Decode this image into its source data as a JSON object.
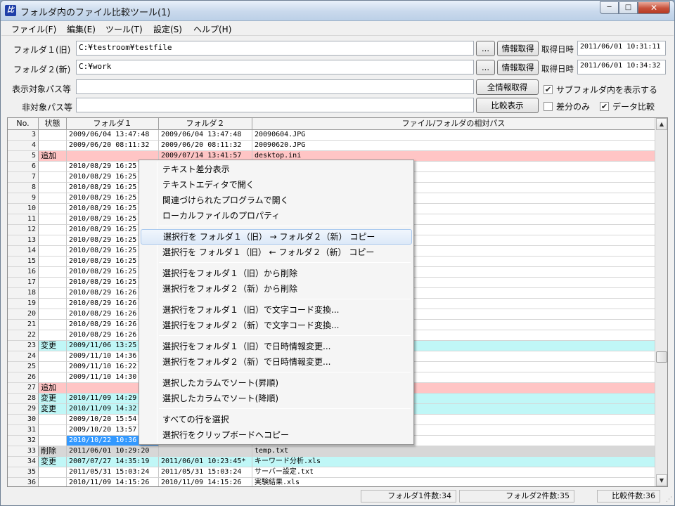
{
  "window": {
    "title": "フォルダ内のファイル比較ツール(1)",
    "app_icon": "比",
    "btn_min": "─",
    "btn_max": "□",
    "btn_close": "✕"
  },
  "menu": [
    "ファイル(F)",
    "編集(E)",
    "ツール(T)",
    "設定(S)",
    "ヘルプ(H)"
  ],
  "form": {
    "folder1_label": "フォルダ１(旧)",
    "folder1_value": "C:¥testroom¥testfile",
    "folder2_label": "フォルダ２(新)",
    "folder2_value": "C:¥work",
    "browse_label": "...",
    "getinfo_label": "情報取得",
    "time_label": "取得日時",
    "time1_value": "2011/06/01 10:31:11",
    "time2_value": "2011/06/01 10:34:32",
    "include_label": "表示対象パス等",
    "include_value": "",
    "exclude_label": "非対象パス等",
    "exclude_value": "",
    "getall_label": "全情報取得",
    "compare_label": "比較表示",
    "subfolder_label": "サブフォルダ内を表示する",
    "subfolder_checked": true,
    "diffonly_label": "差分のみ",
    "diffonly_checked": false,
    "datacompare_label": "データ比較",
    "datacompare_checked": true
  },
  "grid": {
    "headers": [
      "No.",
      "状態",
      "フォルダ１",
      "フォルダ２",
      "ファイル/フォルダの相対パス"
    ],
    "rows": [
      {
        "no": "3",
        "status": "",
        "d1": "2009/06/04 13:47:48",
        "d2": "2009/06/04 13:47:48",
        "path": "20090604.JPG",
        "kind": ""
      },
      {
        "no": "4",
        "status": "",
        "d1": "2009/06/20 08:11:32",
        "d2": "2009/06/20 08:11:32",
        "path": "20090620.JPG",
        "kind": ""
      },
      {
        "no": "5",
        "status": "追加",
        "d1": "",
        "d2": "2009/07/14 13:41:57",
        "path": "desktop.ini",
        "kind": "add"
      },
      {
        "no": "6",
        "status": "",
        "d1": "2010/08/29 16:25",
        "d2": "",
        "path": "",
        "kind": ""
      },
      {
        "no": "7",
        "status": "",
        "d1": "2010/08/29 16:25",
        "d2": "",
        "path": "",
        "kind": ""
      },
      {
        "no": "8",
        "status": "",
        "d1": "2010/08/29 16:25",
        "d2": "",
        "path": "",
        "kind": ""
      },
      {
        "no": "9",
        "status": "",
        "d1": "2010/08/29 16:25",
        "d2": "",
        "path": "",
        "kind": ""
      },
      {
        "no": "10",
        "status": "",
        "d1": "2010/08/29 16:25",
        "d2": "",
        "path": "",
        "kind": ""
      },
      {
        "no": "11",
        "status": "",
        "d1": "2010/08/29 16:25",
        "d2": "",
        "path": "",
        "kind": ""
      },
      {
        "no": "12",
        "status": "",
        "d1": "2010/08/29 16:25",
        "d2": "",
        "path": "",
        "kind": ""
      },
      {
        "no": "13",
        "status": "",
        "d1": "2010/08/29 16:25",
        "d2": "",
        "path": "",
        "kind": ""
      },
      {
        "no": "14",
        "status": "",
        "d1": "2010/08/29 16:25",
        "d2": "",
        "path": "",
        "kind": ""
      },
      {
        "no": "15",
        "status": "",
        "d1": "2010/08/29 16:25",
        "d2": "",
        "path": "",
        "kind": ""
      },
      {
        "no": "16",
        "status": "",
        "d1": "2010/08/29 16:25",
        "d2": "",
        "path": "",
        "kind": ""
      },
      {
        "no": "17",
        "status": "",
        "d1": "2010/08/29 16:25",
        "d2": "",
        "path": "",
        "kind": ""
      },
      {
        "no": "18",
        "status": "",
        "d1": "2010/08/29 16:26",
        "d2": "",
        "path": "",
        "kind": ""
      },
      {
        "no": "19",
        "status": "",
        "d1": "2010/08/29 16:26",
        "d2": "",
        "path": "",
        "kind": ""
      },
      {
        "no": "20",
        "status": "",
        "d1": "2010/08/29 16:26",
        "d2": "",
        "path": "",
        "kind": ""
      },
      {
        "no": "21",
        "status": "",
        "d1": "2010/08/29 16:26",
        "d2": "",
        "path": "",
        "kind": ""
      },
      {
        "no": "22",
        "status": "",
        "d1": "2010/08/29 16:26",
        "d2": "",
        "path": "",
        "kind": ""
      },
      {
        "no": "23",
        "status": "変更",
        "d1": "2009/11/06 13:25",
        "d2": "",
        "path": "",
        "kind": "chg"
      },
      {
        "no": "24",
        "status": "",
        "d1": "2009/11/10 14:36",
        "d2": "",
        "path": "",
        "kind": ""
      },
      {
        "no": "25",
        "status": "",
        "d1": "2009/11/10 16:22",
        "d2": "",
        "path": "",
        "kind": ""
      },
      {
        "no": "26",
        "status": "",
        "d1": "2009/11/10 14:30",
        "d2": "",
        "path": "",
        "kind": ""
      },
      {
        "no": "27",
        "status": "追加",
        "d1": "",
        "d2": "",
        "path": "",
        "kind": "add"
      },
      {
        "no": "28",
        "status": "変更",
        "d1": "2010/11/09 14:29",
        "d2": "",
        "path": "",
        "kind": "chg"
      },
      {
        "no": "29",
        "status": "変更",
        "d1": "2010/11/09 14:32",
        "d2": "",
        "path": "",
        "kind": "chg"
      },
      {
        "no": "30",
        "status": "",
        "d1": "2009/10/20 15:54",
        "d2": "",
        "path": "",
        "kind": ""
      },
      {
        "no": "31",
        "status": "",
        "d1": "2009/10/20 13:57",
        "d2": "",
        "path": "",
        "kind": ""
      },
      {
        "no": "32",
        "status": "",
        "d1": "2010/10/22 10:36",
        "d2": "",
        "path": "",
        "kind": "selected"
      },
      {
        "no": "33",
        "status": "削除",
        "d1": "2011/06/01 10:29:20",
        "d2": "",
        "path": "temp.txt",
        "kind": "del"
      },
      {
        "no": "34",
        "status": "変更",
        "d1": "2007/07/27 14:35:19",
        "d2": "2011/06/01 10:23:45*",
        "path": "キーワード分析.xls",
        "kind": "chg"
      },
      {
        "no": "35",
        "status": "",
        "d1": "2011/05/31 15:03:24",
        "d2": "2011/05/31 15:03:24",
        "path": "サーバー設定.txt",
        "kind": ""
      },
      {
        "no": "36",
        "status": "",
        "d1": "2010/11/09 14:15:26",
        "d2": "2010/11/09 14:15:26",
        "path": "実験結果.xls",
        "kind": ""
      }
    ]
  },
  "context_menu": {
    "groups": [
      [
        "テキスト差分表示",
        "テキストエディタで開く",
        "関連づけられたプログラムで開く",
        "ローカルファイルのプロパティ"
      ],
      [
        "選択行を フォルダ１（旧） → フォルダ２（新） コピー",
        "選択行を フォルダ１（旧） ← フォルダ２（新） コピー"
      ],
      [
        "選択行をフォルダ１（旧）から削除",
        "選択行をフォルダ２（新）から削除"
      ],
      [
        "選択行をフォルダ１（旧）で文字コード変換...",
        "選択行をフォルダ２（新）で文字コード変換..."
      ],
      [
        "選択行をフォルダ１（旧）で日時情報変更...",
        "選択行をフォルダ２（新）で日時情報変更..."
      ],
      [
        "選択したカラムでソート(昇順)",
        "選択したカラムでソート(降順)"
      ],
      [
        "すべての行を選択",
        "選択行をクリップボードへコピー"
      ]
    ],
    "highlighted": "選択行を フォルダ１（旧） → フォルダ２（新） コピー"
  },
  "status": {
    "folder1_count": "フォルダ1件数:34",
    "folder2_count": "フォルダ2件数:35",
    "compare_count": "比較件数:36"
  },
  "colors": {
    "added": "#ffc5c5",
    "changed": "#c0f7f7",
    "deleted": "#d7d7d7",
    "selected": "#3399ff"
  }
}
